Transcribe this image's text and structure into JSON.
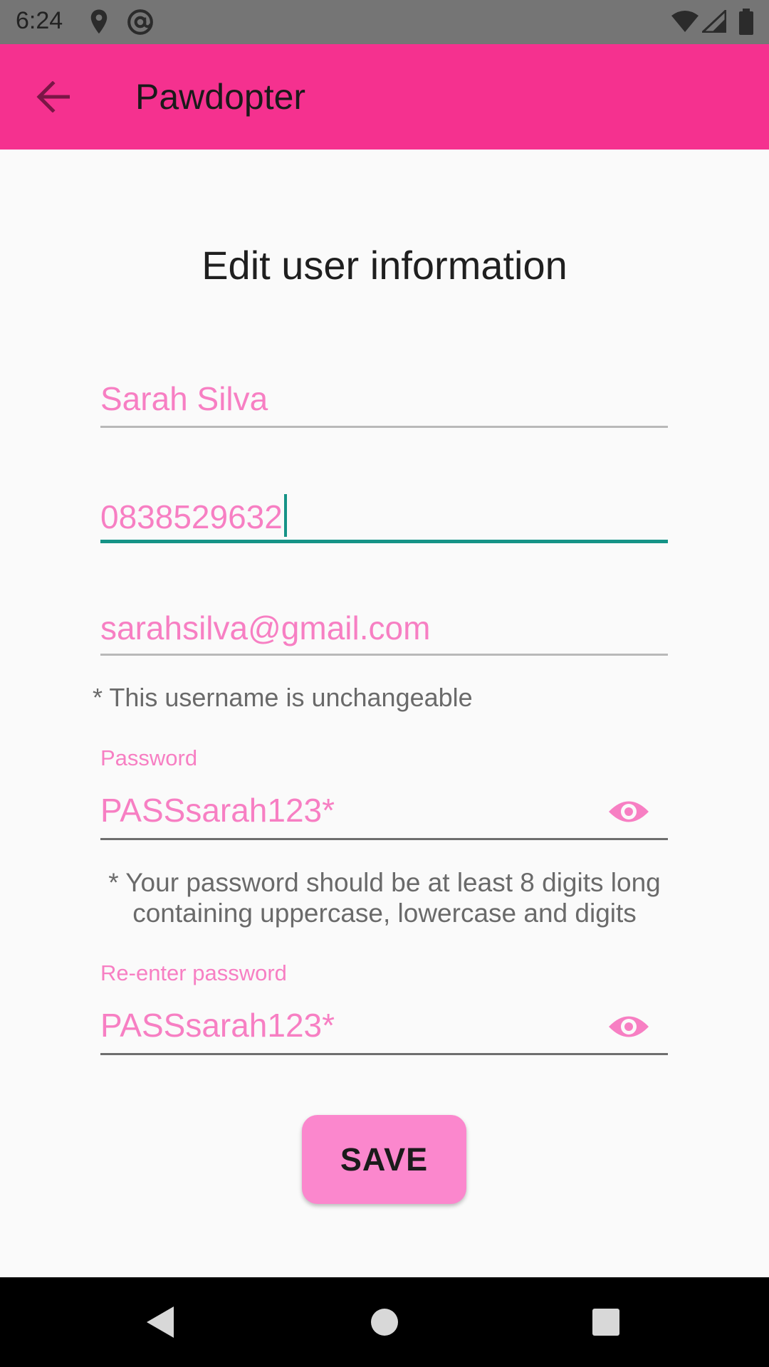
{
  "status_bar": {
    "time": "6:24",
    "icons": [
      "location-icon",
      "at-sign-icon",
      "wifi-icon",
      "signal-icon",
      "battery-icon"
    ]
  },
  "app_bar": {
    "title": "Pawdopter",
    "back_icon": "arrow-back-icon",
    "color": "#f5318f"
  },
  "page": {
    "title": "Edit user information"
  },
  "form": {
    "name_value": "Sarah Silva",
    "phone_value": "0838529632",
    "email_value": "sarahsilva@gmail.com",
    "username_note": "* This username is unchangeable",
    "password_label": "Password",
    "password_value": "PASSsarah123*",
    "password_hint": "* Your password should be at least 8 digits long containing uppercase, lowercase and digits",
    "reenter_label": "Re-enter password",
    "reenter_value": "PASSsarah123*",
    "accent_color": "#f77fc3",
    "focus_color": "#159386"
  },
  "actions": {
    "save_label": "SAVE"
  },
  "nav_bar": {
    "buttons": [
      "back-triangle-icon",
      "home-circle-icon",
      "recents-square-icon"
    ]
  }
}
